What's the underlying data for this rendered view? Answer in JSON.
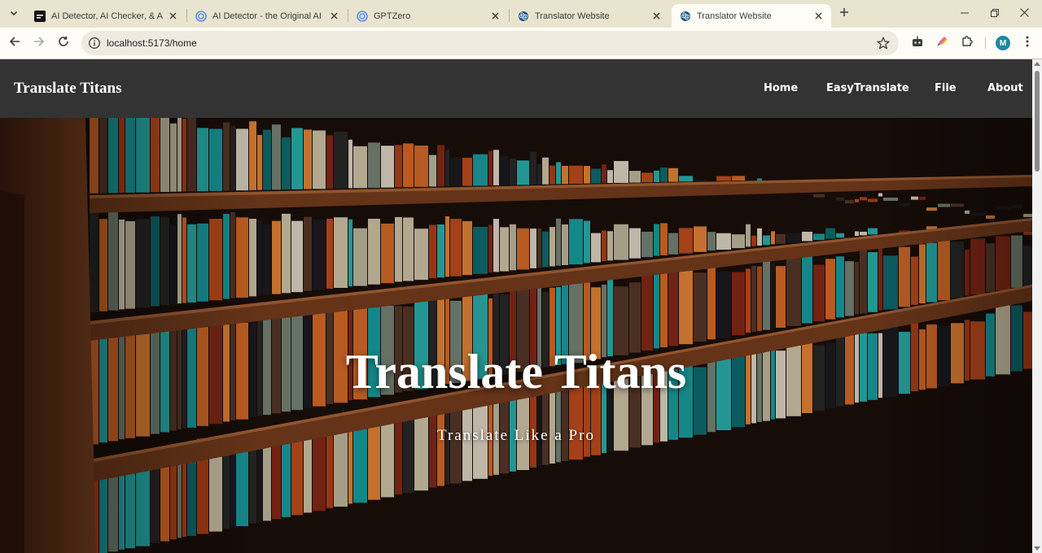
{
  "browser": {
    "tabs": [
      {
        "title": "AI Detector, AI Checker, & AI Hu",
        "favicon": "zerogpt-icon",
        "active": false
      },
      {
        "title": "AI Detector - the Original AI Ch",
        "favicon": "gptzero-icon",
        "active": false
      },
      {
        "title": "GPTZero",
        "favicon": "gptzero-icon",
        "active": false
      },
      {
        "title": "Translator Website",
        "favicon": "react-icon",
        "active": false
      },
      {
        "title": "Translator Website",
        "favicon": "react-icon",
        "active": true
      }
    ],
    "url": "localhost:5173/home",
    "profile_initial": "M",
    "colors": {
      "tabstrip": "#e8e4cf",
      "toolbar": "#fdfcf6",
      "avatar": "#1a8aa0"
    }
  },
  "site": {
    "brand": "Translate Titans",
    "nav": [
      "Home",
      "EasyTranslate",
      "File",
      "About"
    ],
    "hero_title": "Translate Titans",
    "hero_subtitle": "Translate Like a Pro",
    "hero_image": "library-bookshelf-photo",
    "colors": {
      "nav_bg": "#333333",
      "text": "#ffffff"
    }
  }
}
